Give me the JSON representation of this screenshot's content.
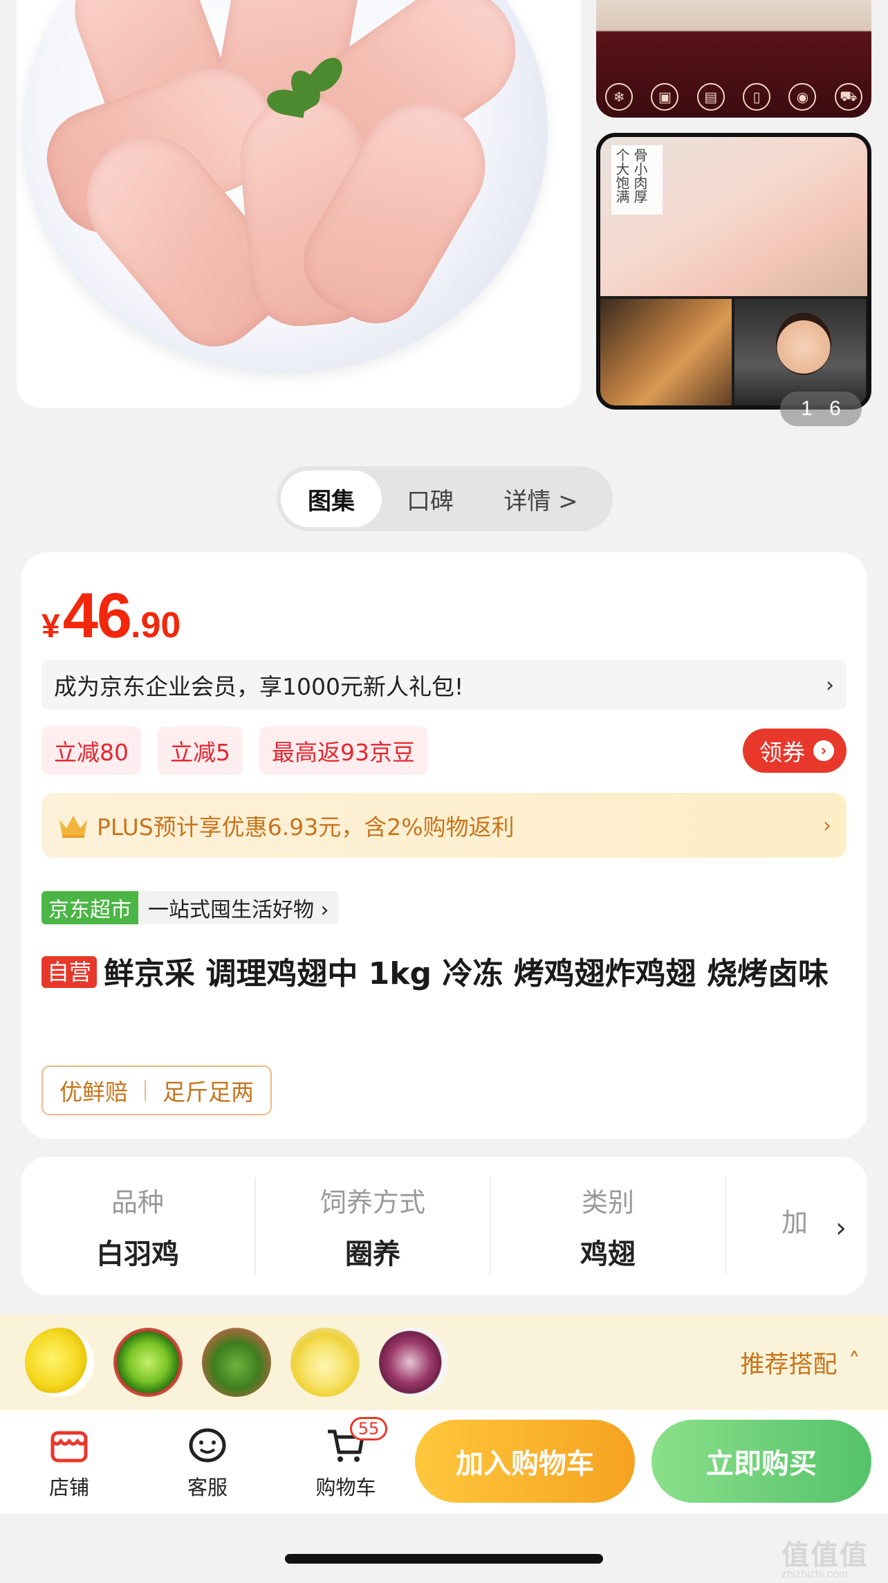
{
  "gallery": {
    "side_badge_lines": [
      "个大饱满",
      "骨小肉厚"
    ],
    "side_icon_names": [
      "snowflake-icon",
      "box-icon",
      "ice-pack-icon",
      "membrane-icon",
      "compensation-icon",
      "cold-chain-truck-icon"
    ],
    "page_current": "1",
    "page_total": "6"
  },
  "tabs": [
    {
      "label": "图集",
      "active": true
    },
    {
      "label": "口碑",
      "active": false
    },
    {
      "label": "详情 >",
      "active": false
    }
  ],
  "price": {
    "currency": "¥",
    "integer": "46",
    "decimal": ".90"
  },
  "member_bar": {
    "text": "成为京东企业会员，享1000元新人礼包!",
    "chevron": "›"
  },
  "coupons": [
    "立减80",
    "立减5",
    "最高返93京豆"
  ],
  "get_coupon": {
    "label": "领券",
    "arrow": "›"
  },
  "plus_bar": {
    "text": "PLUS预计享优惠6.93元，含2%购物返利",
    "chevron": "›"
  },
  "store": {
    "tag": "京东超市",
    "slogan": "一站式囤生活好物 ›"
  },
  "product": {
    "self_tag": "自营",
    "title": "鲜京采 调理鸡翅中 1kg 冷冻 烤鸡翅炸鸡翅 烧烤卤味"
  },
  "guarantees": [
    "优鲜赔",
    "足斤足两"
  ],
  "attributes": [
    {
      "key": "品种",
      "value": "白羽鸡"
    },
    {
      "key": "饲养方式",
      "value": "圈养"
    },
    {
      "key": "类别",
      "value": "鸡翅"
    },
    {
      "key": "加",
      "value": ""
    }
  ],
  "attr_chevron": "›",
  "recommend": {
    "label": "推荐搭配",
    "arrow": "˄",
    "thumbs": [
      "lemon",
      "lime",
      "broccoli",
      "lemon-slices",
      "onion"
    ]
  },
  "bottom_nav": {
    "store_label": "店铺",
    "service_label": "客服",
    "cart_label": "购物车",
    "cart_count": "55",
    "add_cart_label": "加入购物车",
    "buy_now_label": "立即购买"
  },
  "colors": {
    "price_red": "#f2270c",
    "coupon_red": "#e8382b",
    "plus_gold": "#c7741c",
    "store_green": "#4bb545",
    "add_cart": "#f5a321",
    "buy_now": "#55c26a"
  },
  "watermark": {
    "big": "值值值",
    "small": "zhizhizhi.com"
  }
}
